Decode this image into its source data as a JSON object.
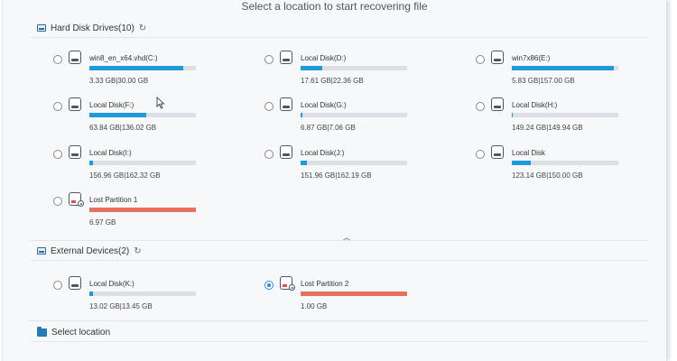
{
  "title": "Select a location to start recovering file",
  "hard_disk_section": {
    "label": "Hard Disk Drives(10)",
    "drives": [
      {
        "name": "win8_en_x64.vhd(C:)",
        "size": "3.33 GB|30.00 GB",
        "fill": 0.88,
        "type": "disk"
      },
      {
        "name": "Local Disk(D:)",
        "size": "17.61 GB|22.36 GB",
        "fill": 0.2,
        "type": "disk"
      },
      {
        "name": "win7x86(E:)",
        "size": "5.83 GB|157.00 GB",
        "fill": 0.96,
        "type": "disk"
      },
      {
        "name": "Local Disk(F:)",
        "size": "63.84 GB|136.02 GB",
        "fill": 0.53,
        "type": "disk"
      },
      {
        "name": "Local Disk(G:)",
        "size": "6.87 GB|7.06 GB",
        "fill": 0.02,
        "type": "disk"
      },
      {
        "name": "Local Disk(H:)",
        "size": "149.24 GB|149.94 GB",
        "fill": 0.01,
        "type": "disk"
      },
      {
        "name": "Local Disk(I:)",
        "size": "156.96 GB|162.32 GB",
        "fill": 0.03,
        "type": "disk"
      },
      {
        "name": "Local Disk(J:)",
        "size": "151.96 GB|162.19 GB",
        "fill": 0.06,
        "type": "disk"
      },
      {
        "name": "Local Disk",
        "size": "123.14 GB|150.00 GB",
        "fill": 0.18,
        "type": "disk"
      },
      {
        "name": "Lost Partition 1",
        "size": "6.97 GB",
        "fill": 1.0,
        "type": "lost"
      }
    ]
  },
  "external_section": {
    "label": "External Devices(2)",
    "drives": [
      {
        "name": "Local Disk(K:)",
        "size": "13.02 GB|13.45 GB",
        "fill": 0.03,
        "type": "disk",
        "selected": false
      },
      {
        "name": "Lost Partition 2",
        "size": "1.00 GB",
        "fill": 1.0,
        "type": "lost",
        "selected": true
      }
    ]
  },
  "select_location_section": {
    "label": "Select location"
  },
  "colors": {
    "accent": "#1c9bd8",
    "lost": "#e8705f",
    "bar_bg": "#dcdfe3"
  },
  "icons": {
    "refresh": "refresh-icon",
    "collapse": "chevron-up-icon"
  }
}
